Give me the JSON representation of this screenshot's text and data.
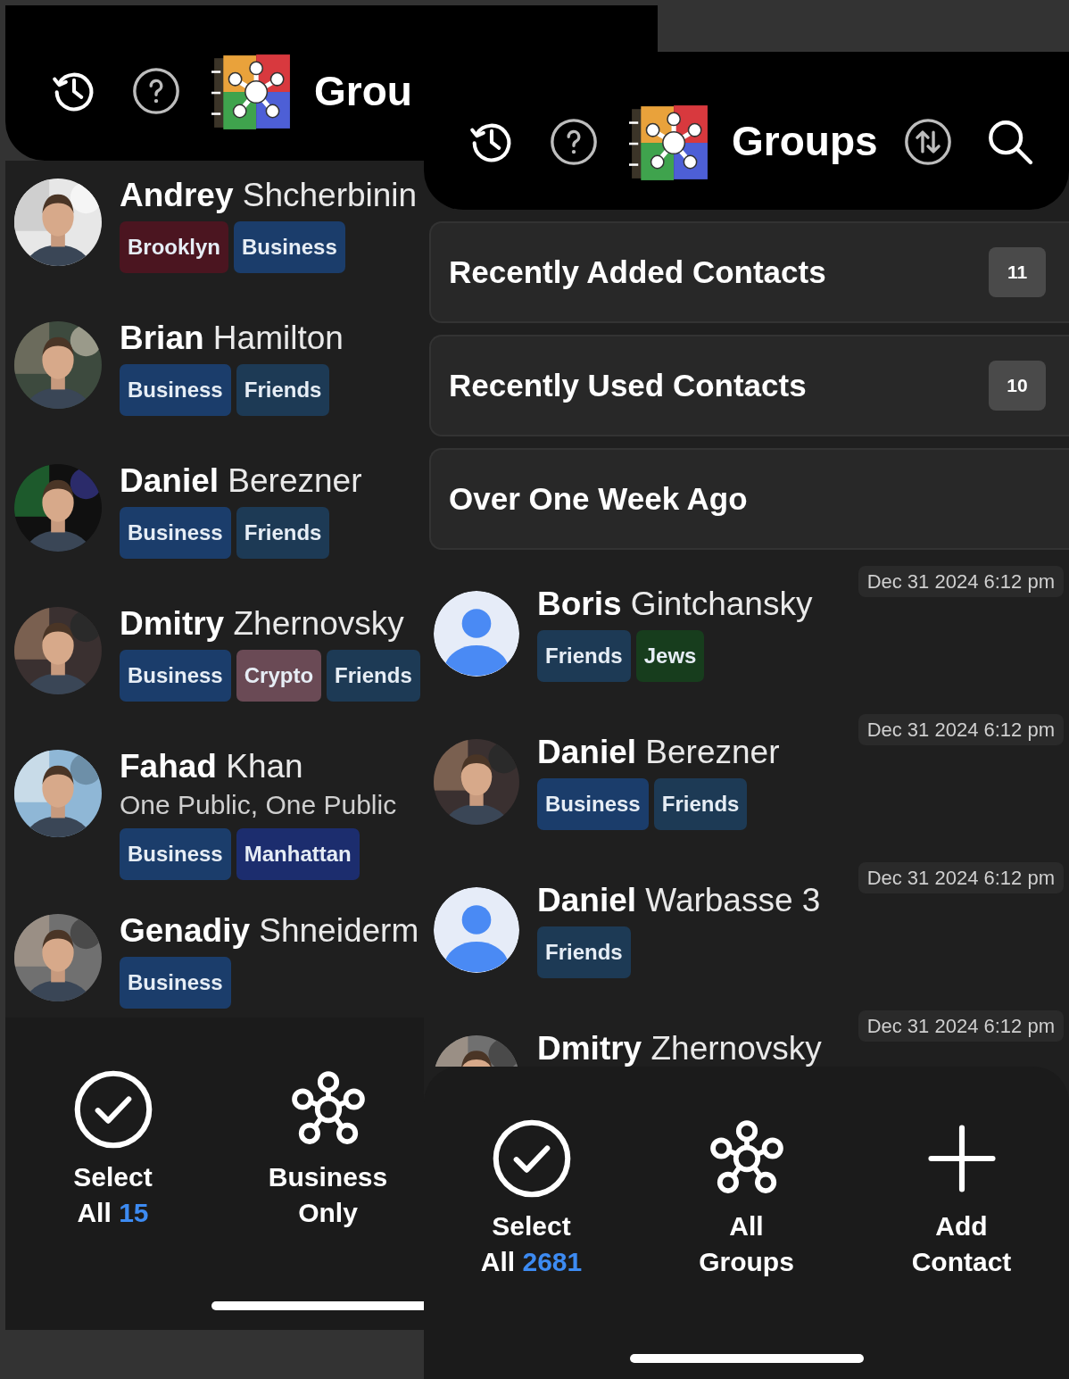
{
  "screens": [
    {
      "kind": "group_view",
      "header": {
        "title": "Grou"
      },
      "contacts": [
        {
          "name": "**Andrey** Shcherbinin",
          "avatar": {
            "kind": "picture"
          },
          "tags": [
            {
              "label": "Brooklyn",
              "color": "#4b1520"
            },
            {
              "label": "Business",
              "color": "#1b3d6b"
            }
          ]
        },
        {
          "name": "**Brian** Hamilton",
          "avatar": {
            "kind": "picture"
          },
          "tags": [
            {
              "label": "Business",
              "color": "#1b3d6b"
            },
            {
              "label": "Friends",
              "color": "#1d3a55"
            }
          ]
        },
        {
          "name": "**Daniel** Berezner",
          "avatar": {
            "kind": "picture"
          },
          "tags": [
            {
              "label": "Business",
              "color": "#1b3d6b"
            },
            {
              "label": "Friends",
              "color": "#1d3a55"
            }
          ]
        },
        {
          "name": "**Dmitry** Zhernovsky",
          "avatar": {
            "kind": "picture"
          },
          "tags": [
            {
              "label": "Business",
              "color": "#1b3d6b"
            },
            {
              "label": "Crypto",
              "color": "#6a4a55"
            },
            {
              "label": "Friends",
              "color": "#1d3a55"
            }
          ]
        },
        {
          "name": "**Fahad** Khan",
          "subtitle": "One Public, One Public",
          "avatar": {
            "kind": "picture"
          },
          "tags": [
            {
              "label": "Business",
              "color": "#1b3d6b"
            },
            {
              "label": "Manhattan",
              "color": "#1c2d6e"
            }
          ]
        },
        {
          "name": "**Genadiy** Shneiderm",
          "avatar": {
            "kind": "picture"
          },
          "tags": [
            {
              "label": "Business",
              "color": "#1b3d6b"
            }
          ]
        }
      ],
      "toolbar": [
        {
          "kind": "select",
          "label": "Select All",
          "count": "15"
        },
        {
          "kind": "groups",
          "label": "Business Only"
        }
      ]
    },
    {
      "kind": "groups_home",
      "header": {
        "title": "Groups"
      },
      "groups": [
        {
          "label": "Recently Added Contacts",
          "count": "11"
        },
        {
          "label": "Recently Used Contacts",
          "count": "10"
        },
        {
          "label": "Over One Week Ago"
        }
      ],
      "contacts": [
        {
          "name": "**Boris** Gintchansky",
          "avatar": {
            "kind": "placeholder"
          },
          "date": "Dec 31 2024 6:12 pm",
          "tags": [
            {
              "label": "Friends",
              "color": "#1d3a55"
            },
            {
              "label": "Jews",
              "color": "#173d1d"
            }
          ]
        },
        {
          "name": "**Daniel** Berezner",
          "avatar": {
            "kind": "picture"
          },
          "date": "Dec 31 2024 6:12 pm",
          "tags": [
            {
              "label": "Business",
              "color": "#1b3d6b"
            },
            {
              "label": "Friends",
              "color": "#1d3a55"
            }
          ]
        },
        {
          "name": "**Daniel** Warbasse 3",
          "avatar": {
            "kind": "placeholder"
          },
          "date": "Dec 31 2024 6:12 pm",
          "tags": [
            {
              "label": "Friends",
              "color": "#1d3a55"
            }
          ]
        },
        {
          "name": "**Dmitry** Zhernovsky",
          "avatar": {
            "kind": "picture"
          },
          "date": "Dec 31 2024 6:12 pm"
        }
      ],
      "toolbar": [
        {
          "kind": "select",
          "label": "Select All",
          "count": "2681"
        },
        {
          "kind": "groups",
          "label": "All Groups"
        },
        {
          "kind": "add",
          "label": "Add Contact"
        }
      ]
    }
  ]
}
